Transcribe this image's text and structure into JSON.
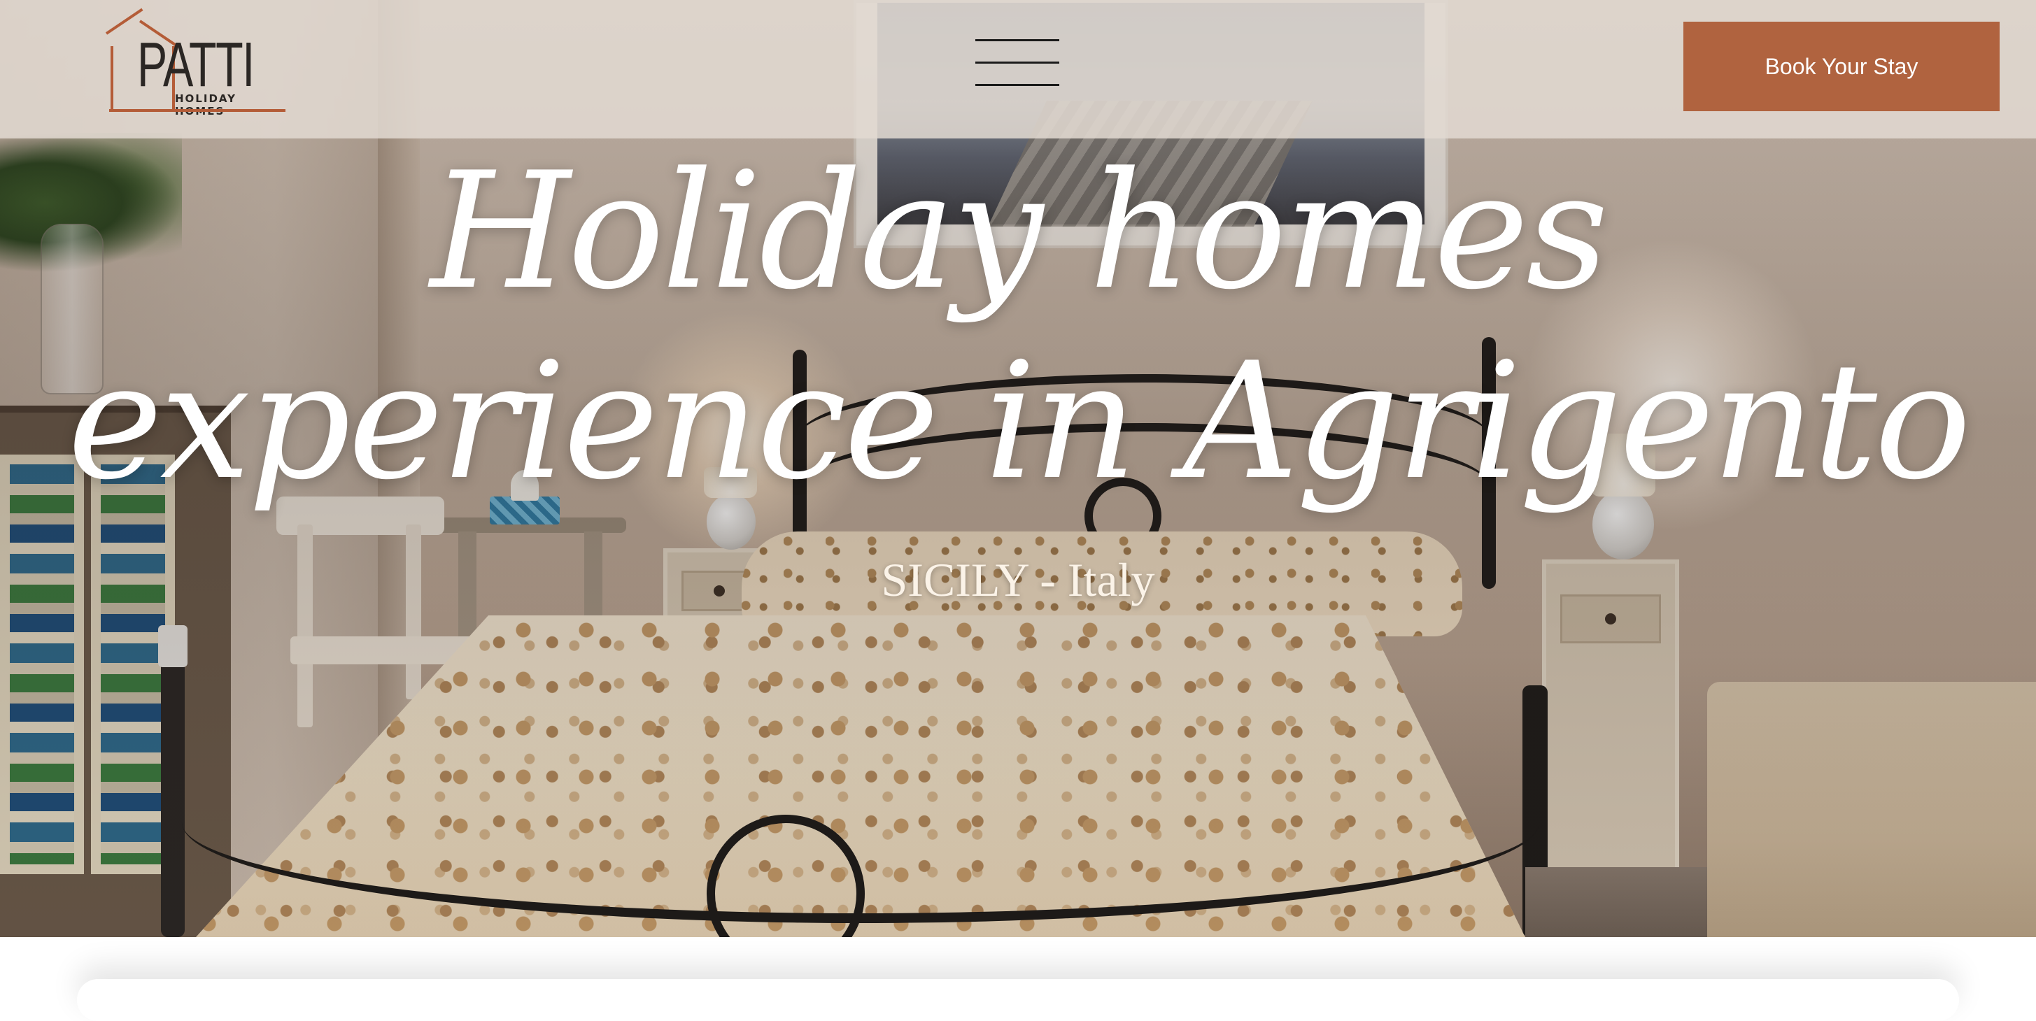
{
  "header": {
    "logo": {
      "wordmark": "PATTI",
      "subtitle": "HOLIDAY HOMES",
      "accent_color": "#b45c37"
    },
    "menu_icon": "hamburger-menu-icon",
    "cta_label": "Book Your Stay",
    "cta_color": "#b0633f"
  },
  "hero": {
    "title_line1": "Holiday homes",
    "title_line2": "experience in Agrigento",
    "subtitle": "SICILY - Italy"
  }
}
